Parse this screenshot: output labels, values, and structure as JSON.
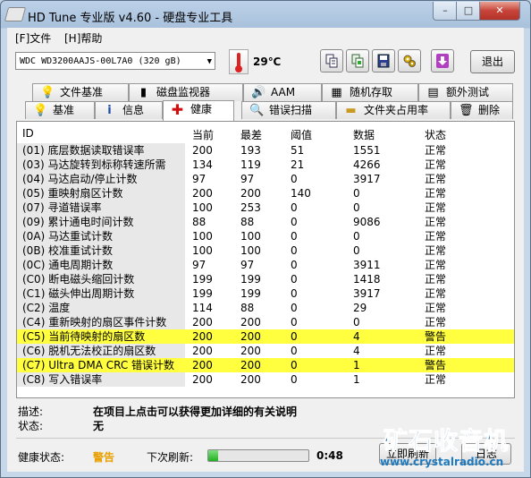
{
  "window": {
    "title": "HD Tune 专业版 v4.60 - 硬盘专业工具",
    "minimize_label": "–",
    "maximize_label": "□",
    "close_label": "✕"
  },
  "menu": {
    "file": "[F]文件",
    "help": "[H]帮助"
  },
  "toolbar": {
    "drive": "WDC WD3200AAJS-00L7A0 (320 gB)",
    "temperature": "29℃",
    "exit_label": "退出",
    "icons": [
      "copy-text-icon",
      "copy-screenshot-icon",
      "save-icon",
      "options-icon",
      "download-icon"
    ]
  },
  "tabs": {
    "row1": [
      "文件基准",
      "磁盘监视器",
      "AAM",
      "随机存取",
      "额外测试"
    ],
    "row2": [
      "基准",
      "信息",
      "健康",
      "错误扫描",
      "文件夹占用率",
      "删除"
    ],
    "active": "健康"
  },
  "table": {
    "headers": [
      "ID",
      "当前",
      "最差",
      "阈值",
      "数据",
      "状态"
    ],
    "rows": [
      {
        "id": "(01) 底层数据读取错误率",
        "current": "200",
        "worst": "193",
        "threshold": "51",
        "data": "1551",
        "status": "正常",
        "warn": false
      },
      {
        "id": "(03) 马达旋转到标称转速所需",
        "current": "134",
        "worst": "119",
        "threshold": "21",
        "data": "4266",
        "status": "正常",
        "warn": false
      },
      {
        "id": "(04) 马达启动/停止计数",
        "current": "97",
        "worst": "97",
        "threshold": "0",
        "data": "3917",
        "status": "正常",
        "warn": false
      },
      {
        "id": "(05) 重映射扇区计数",
        "current": "200",
        "worst": "200",
        "threshold": "140",
        "data": "0",
        "status": "正常",
        "warn": false
      },
      {
        "id": "(07) 寻道错误率",
        "current": "100",
        "worst": "253",
        "threshold": "0",
        "data": "0",
        "status": "正常",
        "warn": false
      },
      {
        "id": "(09) 累计通电时间计数",
        "current": "88",
        "worst": "88",
        "threshold": "0",
        "data": "9086",
        "status": "正常",
        "warn": false
      },
      {
        "id": "(0A) 马达重试计数",
        "current": "100",
        "worst": "100",
        "threshold": "0",
        "data": "0",
        "status": "正常",
        "warn": false
      },
      {
        "id": "(0B) 校准重试计数",
        "current": "100",
        "worst": "100",
        "threshold": "0",
        "data": "0",
        "status": "正常",
        "warn": false
      },
      {
        "id": "(0C) 通电周期计数",
        "current": "97",
        "worst": "97",
        "threshold": "0",
        "data": "3911",
        "status": "正常",
        "warn": false
      },
      {
        "id": "(C0) 断电磁头缩回计数",
        "current": "199",
        "worst": "199",
        "threshold": "0",
        "data": "1418",
        "status": "正常",
        "warn": false
      },
      {
        "id": "(C1) 磁头伸出周期计数",
        "current": "199",
        "worst": "199",
        "threshold": "0",
        "data": "3917",
        "status": "正常",
        "warn": false
      },
      {
        "id": "(C2) 温度",
        "current": "114",
        "worst": "88",
        "threshold": "0",
        "data": "29",
        "status": "正常",
        "warn": false
      },
      {
        "id": "(C4) 重新映射的扇区事件计数",
        "current": "200",
        "worst": "200",
        "threshold": "0",
        "data": "0",
        "status": "正常",
        "warn": false
      },
      {
        "id": "(C5) 当前待映射的扇区数",
        "current": "200",
        "worst": "200",
        "threshold": "0",
        "data": "4",
        "status": "警告",
        "warn": true
      },
      {
        "id": "(C6) 脱机无法校正的扇区数",
        "current": "200",
        "worst": "200",
        "threshold": "0",
        "data": "4",
        "status": "正常",
        "warn": false
      },
      {
        "id": "(C7) Ultra DMA CRC 错误计数",
        "current": "200",
        "worst": "200",
        "threshold": "0",
        "data": "1",
        "status": "警告",
        "warn": true
      },
      {
        "id": "(C8) 写入错误率",
        "current": "200",
        "worst": "200",
        "threshold": "0",
        "data": "1",
        "status": "正常",
        "warn": false
      }
    ]
  },
  "description": {
    "desc_label": "描述:",
    "desc_value": "在项目上点击可以获得更加详细的有关说明",
    "state_label": "状态:",
    "state_value": "无"
  },
  "statusbar": {
    "health_label": "健康状态:",
    "health_value": "警告",
    "next_refresh_label": "下次刷新:",
    "refresh_fraction": 0.1,
    "countdown": "0:48",
    "refresh_button": "立即刷新",
    "log_button": "日志"
  },
  "watermark": {
    "brand": "矿石收音机",
    "url": "www.crystalradio.cn"
  },
  "colors": {
    "warn_row": "#ffff40",
    "health_warn_text": "#e8a000",
    "watermark": "#1e79be"
  }
}
